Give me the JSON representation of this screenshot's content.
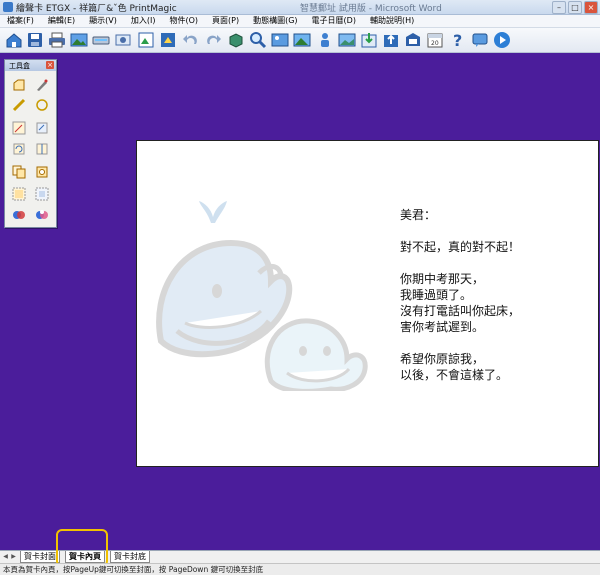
{
  "window": {
    "title": "繪聲卡 ETGX - 祥篇ㄏ&ˇ色 PrintMagic",
    "blurred_title": "智慧郵址 試用版 - Microsoft Word"
  },
  "menu": [
    "檔案(F)",
    "編輯(E)",
    "顯示(V)",
    "加入(I)",
    "物件(O)",
    "頁面(P)",
    "動態構圖(G)",
    "電子日曆(D)",
    "輔助說明(H)"
  ],
  "toolbar_icons": [
    "new-icon",
    "save-icon",
    "print-icon",
    "image-icon",
    "scan-icon",
    "frame-icon",
    "photo-icon",
    "undo-icon",
    "redo-icon",
    "paint-icon",
    "zoom-icon",
    "picture-icon",
    "clipart-icon",
    "landscape-icon",
    "import-icon",
    "export-icon",
    "card-icon",
    "calendar-icon",
    "help-icon",
    "message-icon",
    "play-icon"
  ],
  "toolbox": {
    "title": "工具盒",
    "tools": [
      "shape-icon",
      "pen-icon",
      "line-icon",
      "circle-icon",
      "edit-icon",
      "crop-icon",
      "rotate-icon",
      "flip-icon",
      "copy-icon",
      "paste-icon",
      "group-icon",
      "align-icon",
      "color-icon",
      "effect-icon"
    ]
  },
  "card": {
    "message": "美君：\n\n對不起，真的對不起！\n\n你期中考那天，\n我睡過頭了。\n沒有打電話叫你起床，\n害你考試遲到。\n\n希望你原諒我，\n以後，不會這樣了。"
  },
  "tabs": [
    {
      "label": "賀卡封面"
    },
    {
      "label": "賀卡內頁",
      "active": true
    },
    {
      "label": "賀卡封底"
    }
  ],
  "status_text": "本頁為賀卡內頁，按PageUp鍵可切換至封面，按 PageDown 鍵可切換至封底"
}
